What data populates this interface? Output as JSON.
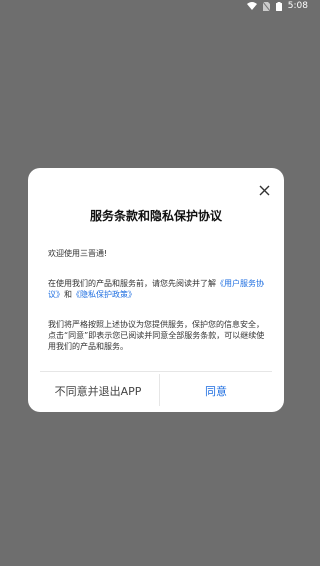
{
  "status_bar": {
    "time": "5:08",
    "icons": [
      "wifi-icon",
      "no-sim-icon",
      "battery-icon"
    ]
  },
  "dialog": {
    "title": "服务条款和隐私保护协议",
    "greeting": "欢迎使用三晋通!",
    "paragraph2_prefix": "在使用我们的产品和服务前，请您先阅读并了解",
    "user_agreement_link": "《用户服务协议》",
    "and_text": "和",
    "privacy_policy_link": "《隐私保护政策》",
    "paragraph3": "我们将严格按照上述协议为您提供服务，保护您的信息安全，点击“同意”即表示您已阅读并同意全部服务条款，可以继续使用我们的产品和服务。",
    "decline_label": "不同意并退出APP",
    "agree_label": "同意",
    "close_icon": "close-icon"
  },
  "colors": {
    "overlay": "#6e6e6e",
    "link": "#1e6ee0"
  }
}
